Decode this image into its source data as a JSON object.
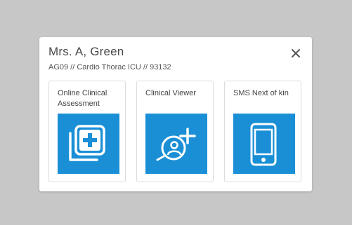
{
  "patient": {
    "name": "Mrs. A, Green",
    "details": "AG09 // Cardio Thorac ICU // 93132"
  },
  "close": {
    "icon": "close-icon"
  },
  "cards": [
    {
      "label": "Online Clinical Assessment",
      "icon": "clinical-assessment-icon"
    },
    {
      "label": "Clinical Viewer",
      "icon": "clinical-viewer-icon"
    },
    {
      "label": "SMS Next of kin",
      "icon": "mobile-phone-icon"
    }
  ],
  "colors": {
    "tile": "#1a8fd6",
    "backdrop": "#c7c7c7"
  }
}
